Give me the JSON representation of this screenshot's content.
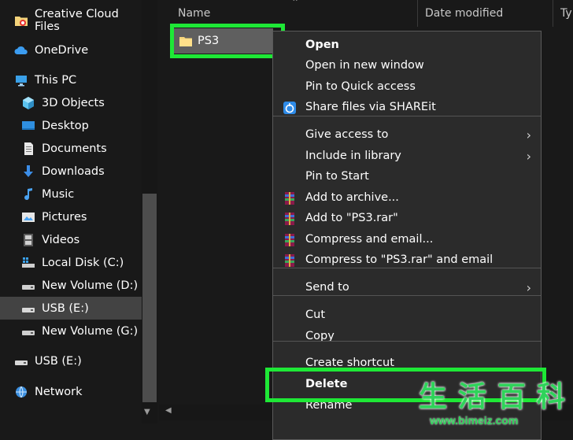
{
  "nav": {
    "items": [
      {
        "label": "Creative Cloud Files",
        "icon": "creative-cloud-folder-icon"
      },
      {
        "label": "OneDrive",
        "icon": "cloud-icon"
      },
      {
        "label": "This PC",
        "icon": "computer-icon"
      },
      {
        "label": "3D Objects",
        "icon": "cube-icon"
      },
      {
        "label": "Desktop",
        "icon": "desktop-icon"
      },
      {
        "label": "Documents",
        "icon": "document-icon"
      },
      {
        "label": "Downloads",
        "icon": "download-arrow-icon"
      },
      {
        "label": "Music",
        "icon": "music-note-icon"
      },
      {
        "label": "Pictures",
        "icon": "picture-icon"
      },
      {
        "label": "Videos",
        "icon": "film-icon"
      },
      {
        "label": "Local Disk (C:)",
        "icon": "windows-drive-icon"
      },
      {
        "label": "New Volume (D:)",
        "icon": "drive-icon"
      },
      {
        "label": "USB (E:)",
        "icon": "usb-drive-icon"
      },
      {
        "label": "New Volume (G:)",
        "icon": "drive-icon"
      },
      {
        "label": "USB (E:)",
        "icon": "usb-drive-icon"
      },
      {
        "label": "Network",
        "icon": "network-icon"
      }
    ],
    "selected_index": 12
  },
  "list": {
    "columns": [
      "Name",
      "Date modified",
      "Ty"
    ],
    "file": {
      "name": "PS3",
      "icon": "folder-icon"
    }
  },
  "context_menu": {
    "groups": [
      [
        {
          "label": "Open",
          "bold": true
        },
        {
          "label": "Open in new window"
        },
        {
          "label": "Pin to Quick access"
        },
        {
          "label": "Share files via SHAREit",
          "icon": "shareit-icon"
        }
      ],
      [
        {
          "label": "Give access to",
          "submenu": true
        },
        {
          "label": "Include in library",
          "submenu": true
        },
        {
          "label": "Pin to Start"
        },
        {
          "label": "Add to archive...",
          "icon": "winrar-icon"
        },
        {
          "label": "Add to \"PS3.rar\"",
          "icon": "winrar-icon"
        },
        {
          "label": "Compress and email...",
          "icon": "winrar-icon"
        },
        {
          "label": "Compress to \"PS3.rar\" and email",
          "icon": "winrar-icon"
        }
      ],
      [
        {
          "label": "Send to",
          "submenu": true
        }
      ],
      [
        {
          "label": "Cut"
        },
        {
          "label": "Copy"
        }
      ],
      [
        {
          "label": "Create shortcut"
        },
        {
          "label": "Delete",
          "bold": true
        },
        {
          "label": "Rename"
        }
      ]
    ]
  },
  "watermark": {
    "chars": [
      "生",
      "活",
      "百",
      "科"
    ],
    "url": "www.bimeiz.com"
  },
  "colors": {
    "highlight": "#1ee836",
    "background": "#191919",
    "menu": "#2b2b2b"
  }
}
